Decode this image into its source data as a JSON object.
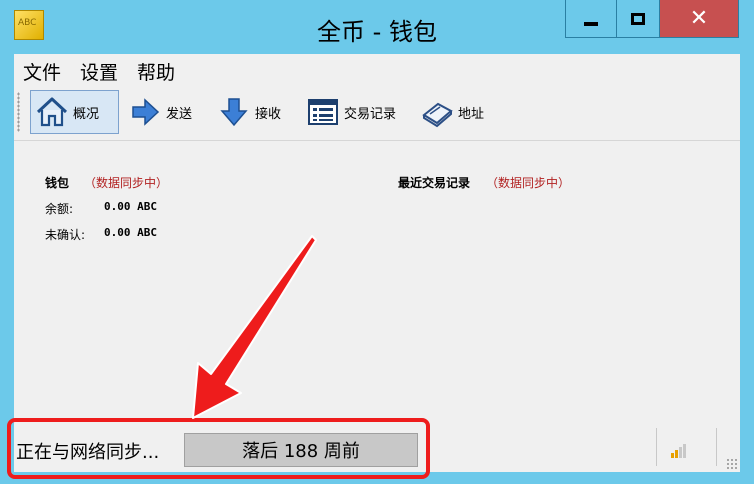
{
  "window": {
    "title": "全币 - 钱包",
    "app_icon_text": "ABC",
    "controls": [
      "minimize-icon",
      "maximize-icon",
      "close-icon"
    ],
    "close_glyph": "✕"
  },
  "menubar": {
    "items": [
      "文件",
      "设置",
      "帮助"
    ]
  },
  "toolbar": {
    "items": [
      {
        "label": "概况",
        "icon": "home-icon",
        "active": true
      },
      {
        "label": "发送",
        "icon": "send-arrow-icon"
      },
      {
        "label": "接收",
        "icon": "receive-arrow-icon"
      },
      {
        "label": "交易记录",
        "icon": "transaction-list-icon"
      },
      {
        "label": "地址",
        "icon": "address-book-icon"
      }
    ]
  },
  "wallet": {
    "heading": "钱包",
    "sync_status": "（数据同步中）",
    "balance_label": "余额:",
    "balance_value": "0.00 ABC",
    "unconfirmed_label": "未确认:",
    "unconfirmed_value": "0.00 ABC"
  },
  "recent": {
    "heading": "最近交易记录",
    "sync_status": "（数据同步中）"
  },
  "statusbar": {
    "status_text": "正在与网络同步...",
    "progress_label": "落后 188 周前",
    "icon": "network-signal-icon"
  },
  "colors": {
    "titlebar": "#6cc9ea",
    "close_button": "#c75050",
    "sync_status": "#b22222",
    "annotation": "#ee1c1c"
  }
}
